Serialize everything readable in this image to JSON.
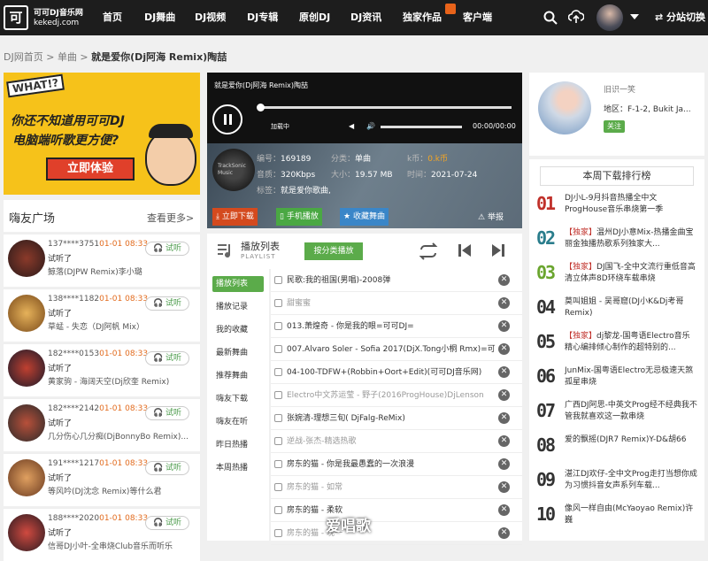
{
  "header": {
    "logo_mark": "可",
    "logo_title": "可可DJ音乐网",
    "logo_domain": "kekedj.com",
    "nav": [
      "首页",
      "DJ舞曲",
      "DJ视频",
      "DJ专辑",
      "原创DJ",
      "DJ资讯",
      "独家作品",
      "客户端"
    ],
    "switch_label": "分站切换",
    "icons": [
      "search-icon",
      "cloud-upload-icon",
      "chevron-down-icon",
      "switch-icon"
    ]
  },
  "breadcrumb": {
    "home": "DJ网首页",
    "sep1": " > ",
    "cat": "单曲",
    "sep2": " > ",
    "current": "就是爱你(Dj阿海 Remix)陶喆"
  },
  "banner": {
    "badge": "WHAT!?",
    "line1": "你还不知道用可可DJ",
    "line2": "电脑端听歌更方便?",
    "button": "立即体验"
  },
  "friends": {
    "title": "嗨友广场",
    "more": "查看更多>",
    "listen_label": "试听",
    "items": [
      {
        "user": "137****3751",
        "time": "01-01 08:33",
        "did": "试听了",
        "song": "鲸落(DJPW Remix)李小璐"
      },
      {
        "user": "138****1182",
        "time": "01-01 08:33",
        "did": "试听了",
        "song": "草蜢 - 失恋（DJ阿帆 Mix）"
      },
      {
        "user": "182****0153",
        "time": "01-01 08:33",
        "did": "试听了",
        "song": "黄家驹 - 海阔天空(Dj欣奎 Remix)"
      },
      {
        "user": "182****2142",
        "time": "01-01 08:33",
        "did": "试听了",
        "song": "几分伤心几分痴(DjBonnyBo Remix)..."
      },
      {
        "user": "191****1217",
        "time": "01-01 08:33",
        "did": "试听了",
        "song": "等风吟(DJ沈念 Remix)等什么君"
      },
      {
        "user": "188****2020",
        "time": "01-01 08:33",
        "did": "试听了",
        "song": "信哥DJ小叶-全串烧Club音乐而听乐"
      }
    ]
  },
  "player": {
    "title": "就是爱你(Dj阿海 Remix)陶喆",
    "loading": "加载中",
    "time": "00:00/00:00",
    "disc_text": "TrackSonic Music",
    "meta": [
      {
        "k": "编号：",
        "v": "169189"
      },
      {
        "k": "分类：",
        "v": "单曲"
      },
      {
        "k": "k币：",
        "v": "0.k币"
      },
      {
        "k": "音质：",
        "v": "320Kbps"
      },
      {
        "k": "大小：",
        "v": "19.57 MB"
      },
      {
        "k": "时间：",
        "v": "2021-07-24"
      },
      {
        "k": "标签：",
        "v": "就是爱你歌曲,"
      }
    ],
    "btn_download": "立即下载",
    "btn_mobile": "手机播放",
    "btn_fav": "收藏舞曲",
    "report": "举报"
  },
  "playlist": {
    "title": "播放列表",
    "sub": "PLAYLIST",
    "category_btn": "按分类播放",
    "side": [
      "播放列表",
      "播放记录",
      "我的收藏",
      "最新舞曲",
      "推荐舞曲",
      "嗨友下载",
      "嗨友在听",
      "昨日热播",
      "本周热播"
    ],
    "songs": [
      {
        "title": "民歌:我的祖国(男唱)-2008弹",
        "dim": false
      },
      {
        "title": "甜蜜蜜",
        "dim": true
      },
      {
        "title": "013.萧煌奇 - 你是我的眼=可可DJ=",
        "dim": false
      },
      {
        "title": "007.Alvaro Soler - Sofia 2017(DjX.Tong小桐 Rmx)=可可",
        "dim": false
      },
      {
        "title": "04-100-TDFW+(Robbin+Oort+Edit)(可可DJ音乐网)",
        "dim": false
      },
      {
        "title": "Electro中文苏运莹 - 野子(2016ProgHouse)DjLenson",
        "dim": true
      },
      {
        "title": "张婉清-理想三旬( DjFalg-ReMix)",
        "dim": false
      },
      {
        "title": "逆战-张杰-精选热歌",
        "dim": true
      },
      {
        "title": "房东的猫 - 你是我最愚蠢的一次浪漫",
        "dim": false
      },
      {
        "title": "房东的猫 - 如常",
        "dim": true
      },
      {
        "title": "房东的猫 - 柔软",
        "dim": false
      },
      {
        "title": "房东的猫 - 晚一",
        "dim": true
      }
    ]
  },
  "user_card": {
    "name": "旧识一笑",
    "area": "地区：F-1-2, Bukit Ja...",
    "follow": "关注"
  },
  "ranking": {
    "title": "本周下载排行榜",
    "items": [
      {
        "n": "01",
        "color": "#c0302a",
        "tag": "",
        "text": "DJ小L-9月抖音热播全中文ProgHouse音乐串烧第一季"
      },
      {
        "n": "02",
        "color": "#2a7d8c",
        "tag": "【独家】",
        "text": "温州DJ小意Mix-热播金曲宝丽金独播热歌系列独家大..."
      },
      {
        "n": "03",
        "color": "#6aa52e",
        "tag": "【独家】",
        "text": "DJ国飞-全中文流行重低音高清立体声8D环绕车载串烧"
      },
      {
        "n": "04",
        "color": "#333",
        "tag": "",
        "text": "莫叫姐姐 - 吴哥窟(DJ小K&Dj考哥 Remix)"
      },
      {
        "n": "05",
        "color": "#333",
        "tag": "【独家】",
        "text": "dj黎龙-国粤语Electro音乐精心编排倾心制作的超特别的..."
      },
      {
        "n": "06",
        "color": "#333",
        "tag": "",
        "text": "JunMix-国粤语Electro无忌极速天煞孤星串烧"
      },
      {
        "n": "07",
        "color": "#333",
        "tag": "",
        "text": "广西DJ阿思-中英文Prog经不经典我不管我就喜欢这一款串烧"
      },
      {
        "n": "08",
        "color": "#333",
        "tag": "",
        "text": "爱的飘摇(DJR7 Remix)Y-D&胡66"
      },
      {
        "n": "09",
        "color": "#333",
        "tag": "",
        "text": "湛江DJ欢仔-全中文Prog走打当想你成为习惯抖音女声系列车载..."
      },
      {
        "n": "10",
        "color": "#333",
        "tag": "",
        "text": "像风一样自由(McYaoyao Remix)许巍"
      }
    ]
  },
  "watermark": "爱唱歌"
}
